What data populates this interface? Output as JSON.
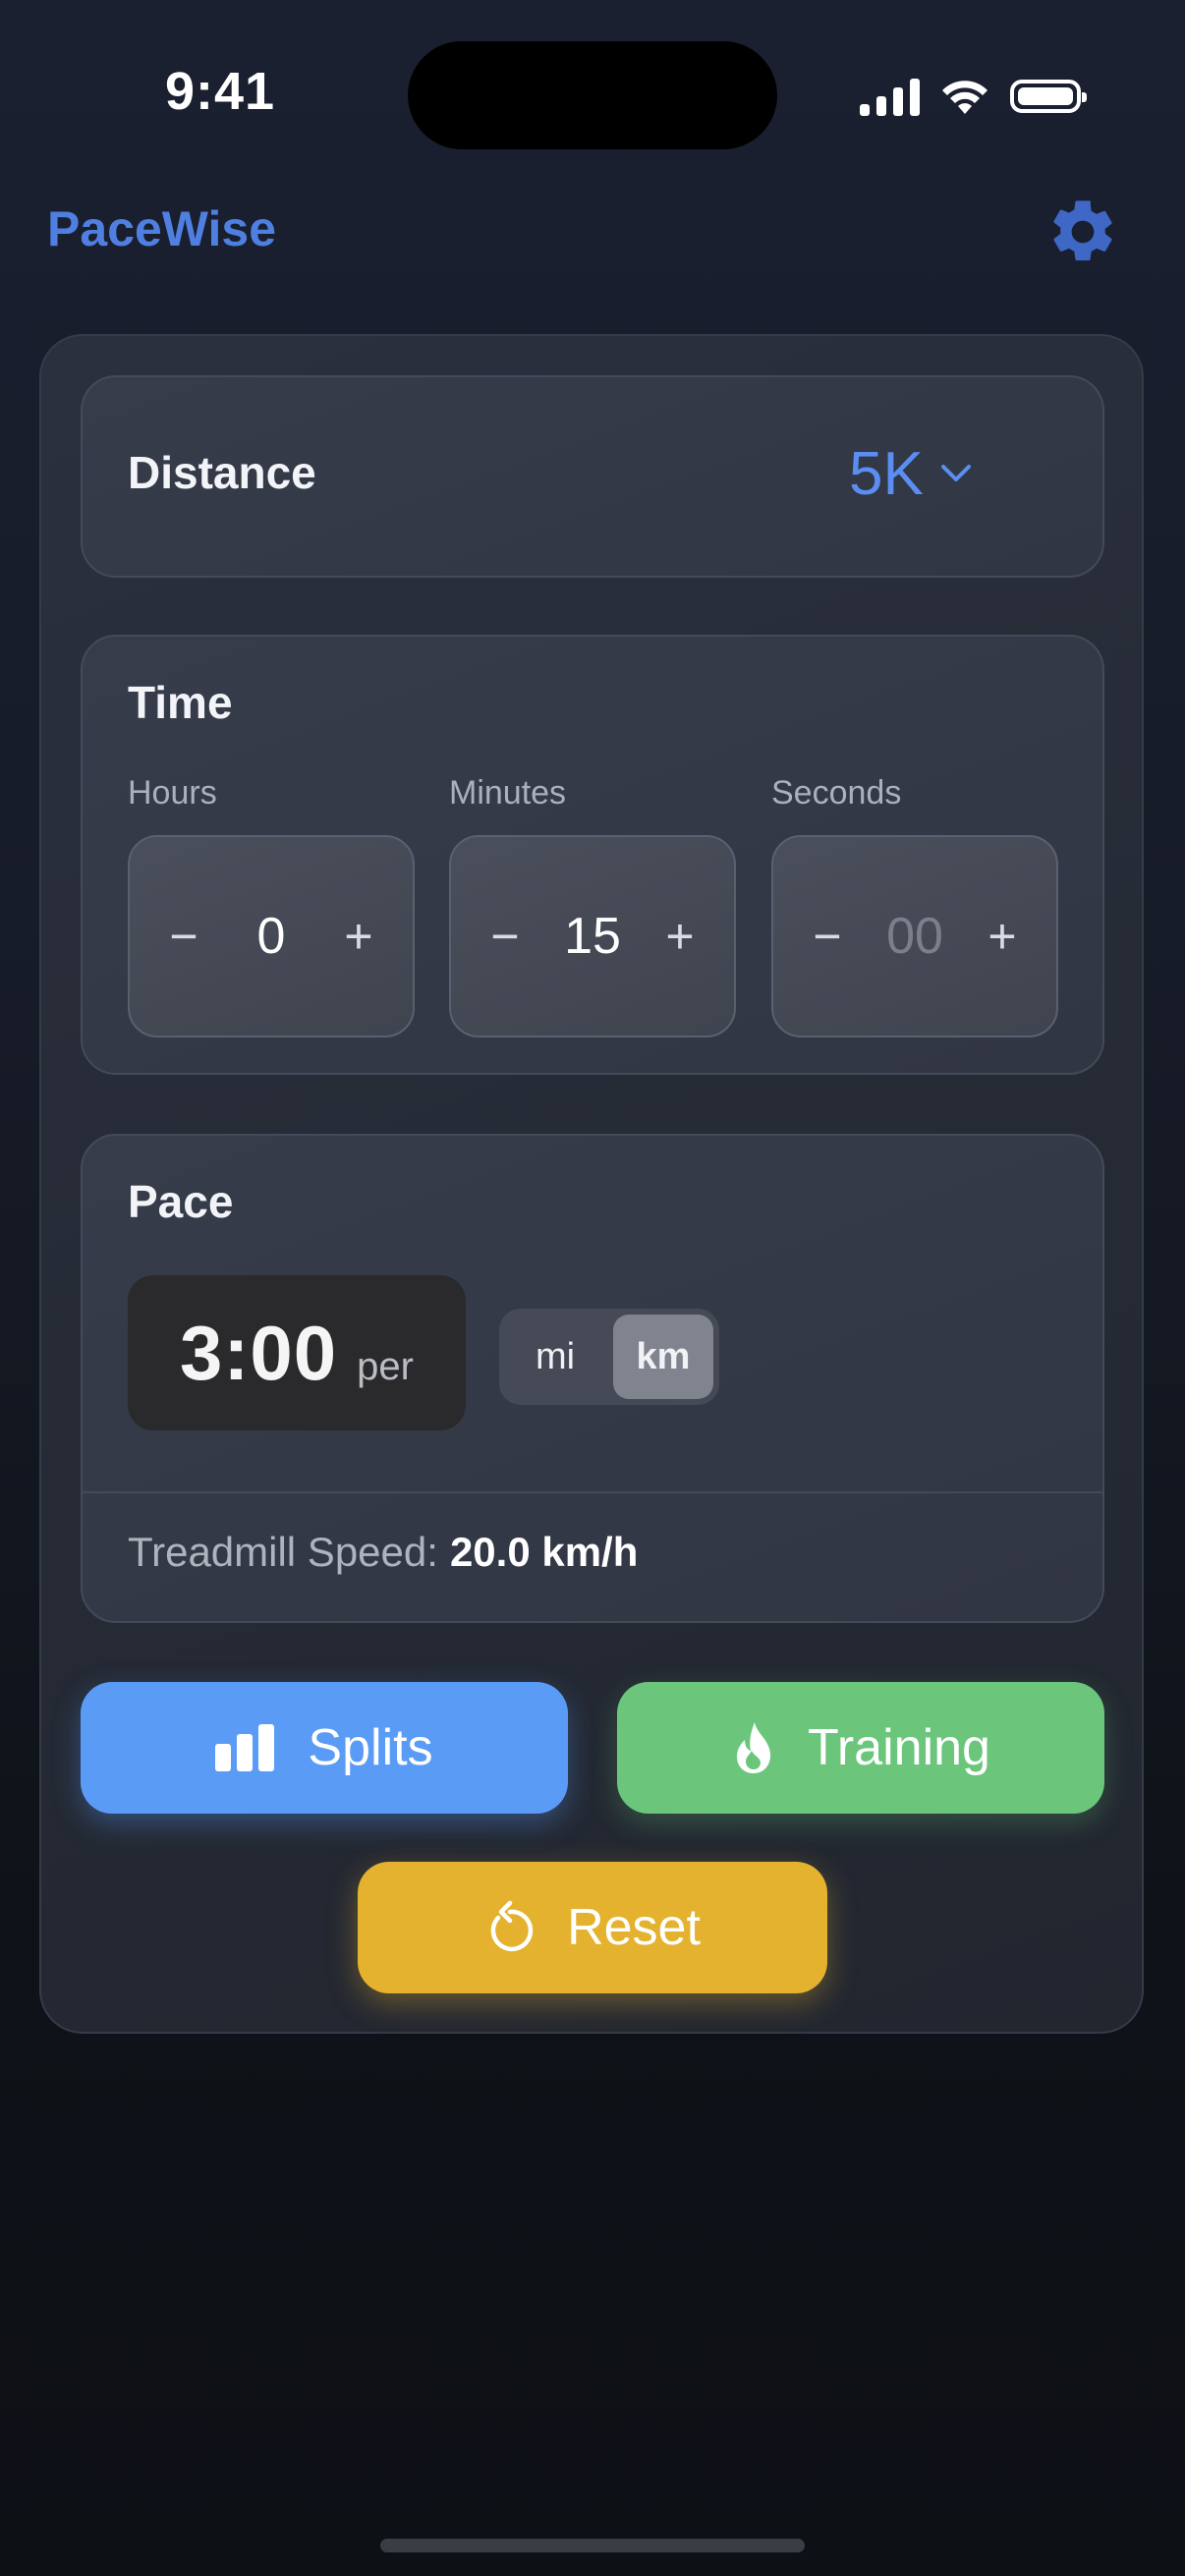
{
  "status_bar": {
    "time": "9:41"
  },
  "header": {
    "title": "PaceWise",
    "settings_icon": "gear-icon"
  },
  "distance": {
    "label": "Distance",
    "selected": "5K"
  },
  "time": {
    "label": "Time",
    "fields": [
      {
        "label": "Hours",
        "value": "0",
        "placeholder": ""
      },
      {
        "label": "Minutes",
        "value": "15",
        "placeholder": ""
      },
      {
        "label": "Seconds",
        "value": "",
        "placeholder": "00"
      }
    ],
    "decrement_symbol": "−",
    "increment_symbol": "+"
  },
  "pace": {
    "label": "Pace",
    "value": "3:00",
    "per": "per",
    "units": [
      "mi",
      "km"
    ],
    "selected_unit": "km",
    "treadmill_label": "Treadmill Speed:",
    "treadmill_value": "20.0 km/h"
  },
  "actions": {
    "splits_label": "Splits",
    "training_label": "Training",
    "reset_label": "Reset"
  },
  "colors": {
    "accent_blue": "#5a9cf5",
    "accent_green": "#6bc67c",
    "accent_yellow": "#e4b22e",
    "title_blue": "#4f7fe0"
  }
}
